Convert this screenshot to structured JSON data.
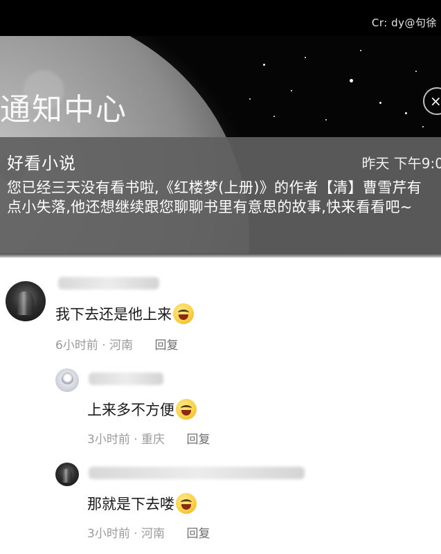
{
  "credit": "Cr: dy@句徐",
  "notification": {
    "header": "通知中心",
    "close_icon": "×",
    "app_name": "好看小说",
    "time": "昨天 下午9:0",
    "body": "您已经三天没有看书啦,《红楼梦(上册)》的作者【清】曹雪芹有点小失落,他还想继续跟您聊聊书里有意思的故事,快来看看吧~"
  },
  "comments": [
    {
      "text": "我下去还是他上来",
      "emoji": "grin-emoji",
      "time": "6小时前",
      "location": "河南",
      "reply_label": "回复"
    },
    {
      "text": "上来多不方便",
      "emoji": "laugh-emoji",
      "time": "3小时前",
      "location": "重庆",
      "reply_label": "回复"
    },
    {
      "text": "那就是下去喽",
      "emoji": "smirk-emoji",
      "time": "3小时前",
      "location": "河南",
      "reply_label": "回复"
    }
  ],
  "meta_separator": "·"
}
